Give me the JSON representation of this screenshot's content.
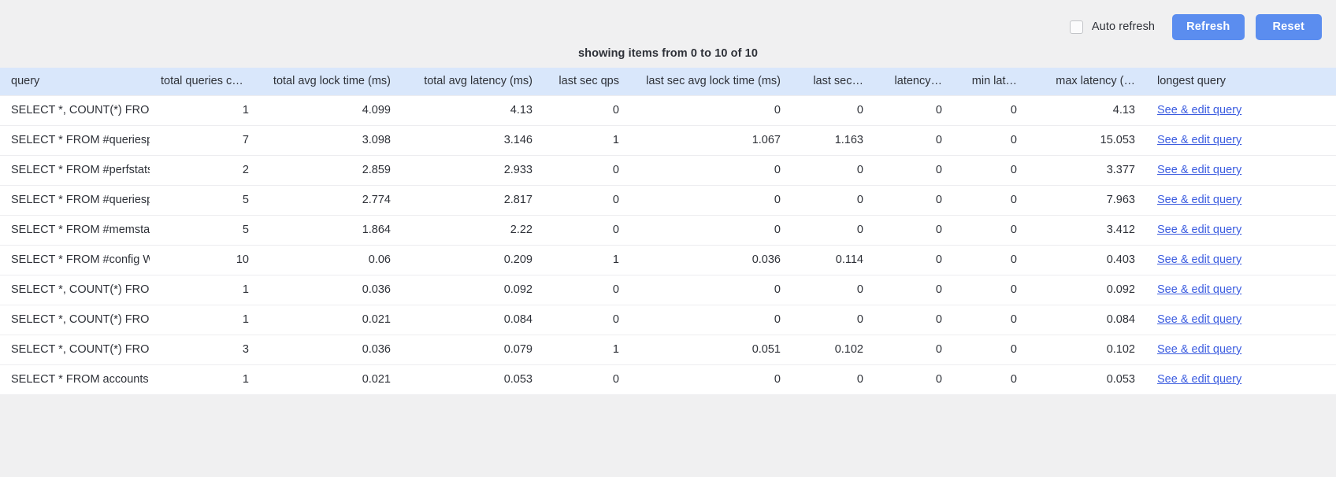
{
  "toolbar": {
    "auto_refresh_label": "Auto refresh",
    "auto_refresh_checked": false,
    "refresh_label": "Refresh",
    "reset_label": "Reset",
    "accent_color": "#5b8def"
  },
  "caption": "showing items from 0 to 10 of 10",
  "table": {
    "header_bg": "#d9e7fb",
    "link_color": "#3b5ce0",
    "columns": [
      "query",
      "total queries count",
      "total avg lock time (ms)",
      "total avg latency (ms)",
      "last sec qps",
      "last sec avg lock time (ms)",
      "last sec…",
      "latency…",
      "min lat…",
      "max latency (…",
      "longest query"
    ],
    "link_label": "See & edit query",
    "rows": [
      {
        "query": "SELECT *, COUNT(*) FROM #a",
        "total_queries_count": "1",
        "total_avg_lock_time": "4.099",
        "total_avg_latency": "4.13",
        "last_sec_qps": "0",
        "last_sec_avg_lock_time": "0",
        "last_sec": "0",
        "latency": "0",
        "min_latency": "0",
        "max_latency": "4.13"
      },
      {
        "query": "SELECT * FROM #queriesperf",
        "total_queries_count": "7",
        "total_avg_lock_time": "3.098",
        "total_avg_latency": "3.146",
        "last_sec_qps": "1",
        "last_sec_avg_lock_time": "1.067",
        "last_sec": "1.163",
        "latency": "0",
        "min_latency": "0",
        "max_latency": "15.053"
      },
      {
        "query": "SELECT * FROM #perfstats OR",
        "total_queries_count": "2",
        "total_avg_lock_time": "2.859",
        "total_avg_latency": "2.933",
        "last_sec_qps": "0",
        "last_sec_avg_lock_time": "0",
        "last_sec": "0",
        "latency": "0",
        "min_latency": "0",
        "max_latency": "3.377"
      },
      {
        "query": "SELECT * FROM #queriesperf",
        "total_queries_count": "5",
        "total_avg_lock_time": "2.774",
        "total_avg_latency": "2.817",
        "last_sec_qps": "0",
        "last_sec_avg_lock_time": "0",
        "last_sec": "0",
        "latency": "0",
        "min_latency": "0",
        "max_latency": "7.963"
      },
      {
        "query": "SELECT * FROM #memstats C",
        "total_queries_count": "5",
        "total_avg_lock_time": "1.864",
        "total_avg_latency": "2.22",
        "last_sec_qps": "0",
        "last_sec_avg_lock_time": "0",
        "last_sec": "0",
        "latency": "0",
        "min_latency": "0",
        "max_latency": "3.412"
      },
      {
        "query": "SELECT * FROM #config WHE",
        "total_queries_count": "10",
        "total_avg_lock_time": "0.06",
        "total_avg_latency": "0.209",
        "last_sec_qps": "1",
        "last_sec_avg_lock_time": "0.036",
        "last_sec": "0.114",
        "latency": "0",
        "min_latency": "0",
        "max_latency": "0.403"
      },
      {
        "query": "SELECT *, COUNT(*) FROM ac",
        "total_queries_count": "1",
        "total_avg_lock_time": "0.036",
        "total_avg_latency": "0.092",
        "last_sec_qps": "0",
        "last_sec_avg_lock_time": "0",
        "last_sec": "0",
        "latency": "0",
        "min_latency": "0",
        "max_latency": "0.092"
      },
      {
        "query": "SELECT *, COUNT(*) FROM ac",
        "total_queries_count": "1",
        "total_avg_lock_time": "0.021",
        "total_avg_latency": "0.084",
        "last_sec_qps": "0",
        "last_sec_avg_lock_time": "0",
        "last_sec": "0",
        "latency": "0",
        "min_latency": "0",
        "max_latency": "0.084"
      },
      {
        "query": "SELECT *, COUNT(*) FROM #c",
        "total_queries_count": "3",
        "total_avg_lock_time": "0.036",
        "total_avg_latency": "0.079",
        "last_sec_qps": "1",
        "last_sec_avg_lock_time": "0.051",
        "last_sec": "0.102",
        "latency": "0",
        "min_latency": "0",
        "max_latency": "0.102"
      },
      {
        "query": "SELECT * FROM accounts",
        "total_queries_count": "1",
        "total_avg_lock_time": "0.021",
        "total_avg_latency": "0.053",
        "last_sec_qps": "0",
        "last_sec_avg_lock_time": "0",
        "last_sec": "0",
        "latency": "0",
        "min_latency": "0",
        "max_latency": "0.053"
      }
    ]
  }
}
